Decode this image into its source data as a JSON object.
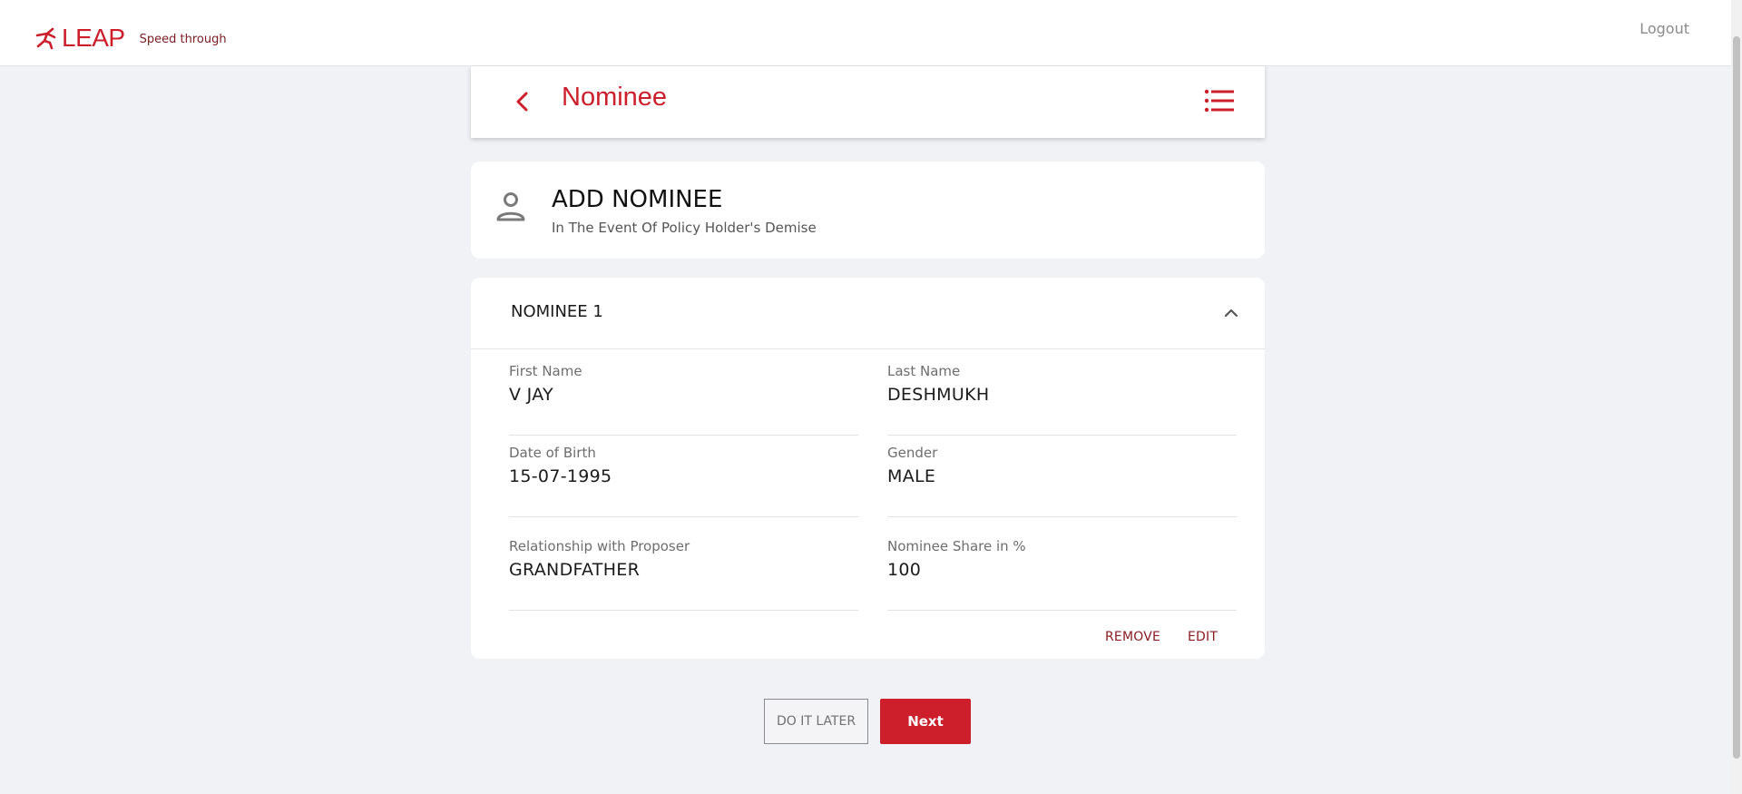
{
  "app": {
    "brand_name": "LEAP",
    "tagline": "Speed through",
    "logout_label": "Logout",
    "accent_color": "#cc1f2b"
  },
  "header": {
    "title": "Nominee",
    "back_icon": "chevron-left-icon",
    "menu_icon": "list-icon"
  },
  "info": {
    "icon": "person-icon",
    "title": "ADD NOMINEE",
    "subtitle": "In The Event Of Policy Holder's Demise"
  },
  "nominee": {
    "title": "NOMINEE 1",
    "collapse_icon": "chevron-up-icon",
    "fields": {
      "first_name": {
        "label": "First Name",
        "value": "V JAY"
      },
      "last_name": {
        "label": "Last Name",
        "value": "DESHMUKH"
      },
      "dob": {
        "label": "Date of Birth",
        "value": "15-07-1995"
      },
      "gender": {
        "label": "Gender",
        "value": "MALE"
      },
      "relationship": {
        "label": "Relationship with Proposer",
        "value": "GRANDFATHER"
      },
      "share": {
        "label": "Nominee Share in %",
        "value": "100"
      }
    },
    "remove_label": "REMOVE",
    "edit_label": "EDIT"
  },
  "footer": {
    "later_label": "DO IT LATER",
    "next_label": "Next"
  }
}
